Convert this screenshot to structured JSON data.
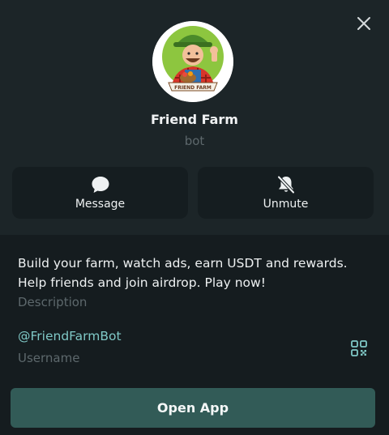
{
  "profile": {
    "name": "Friend Farm",
    "type": "bot",
    "avatar_banner_text": "FRIEND FARM"
  },
  "actions": {
    "message_label": "Message",
    "unmute_label": "Unmute"
  },
  "info": {
    "description": "Build your farm, watch ads, earn USDT and rewards. Help friends and join airdrop. Play now!",
    "description_caption": "Description",
    "username": "@FriendFarmBot",
    "username_caption": "Username"
  },
  "footer": {
    "open_app_label": "Open App"
  },
  "icons": {
    "close": "close-icon",
    "message": "chat-bubble-icon",
    "unmute": "bell-off-icon",
    "qr": "qr-code-icon"
  },
  "colors": {
    "background": "#151c1f",
    "header_background": "#1c2528",
    "accent": "#325b57",
    "link": "#7fc8c6"
  }
}
